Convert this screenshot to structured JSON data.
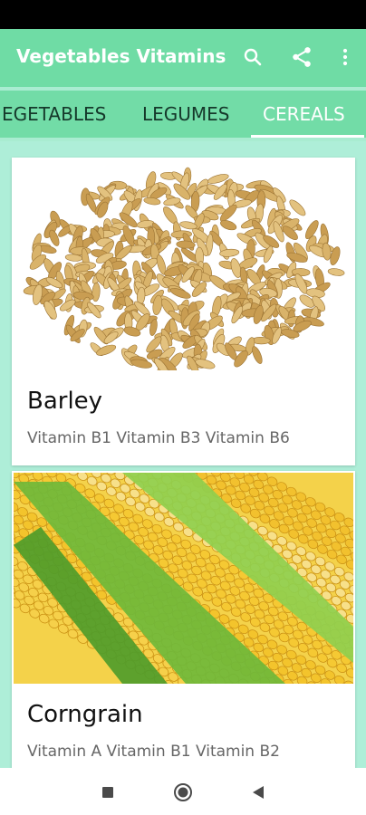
{
  "app": {
    "title": "Vegetables Vitamins",
    "accent_color": "#6fdca5",
    "actions": [
      {
        "name": "search-icon"
      },
      {
        "name": "share-icon"
      },
      {
        "name": "more-vert-icon"
      }
    ]
  },
  "tabs": [
    {
      "label": "EGETABLES",
      "active": false
    },
    {
      "label": "LEGUMES",
      "active": false
    },
    {
      "label": "CEREALS",
      "active": true
    }
  ],
  "cards": [
    {
      "title": "Barley",
      "vitamins": "Vitamin B1 Vitamin B3 Vitamin B6",
      "image": "barley-grains"
    },
    {
      "title": "Corngrain",
      "vitamins": "Vitamin A Vitamin B1 Vitamin B2",
      "image": "corn-cobs"
    }
  ],
  "navigation": {
    "buttons": [
      {
        "name": "recent-apps-icon"
      },
      {
        "name": "home-icon"
      },
      {
        "name": "back-icon"
      }
    ]
  }
}
